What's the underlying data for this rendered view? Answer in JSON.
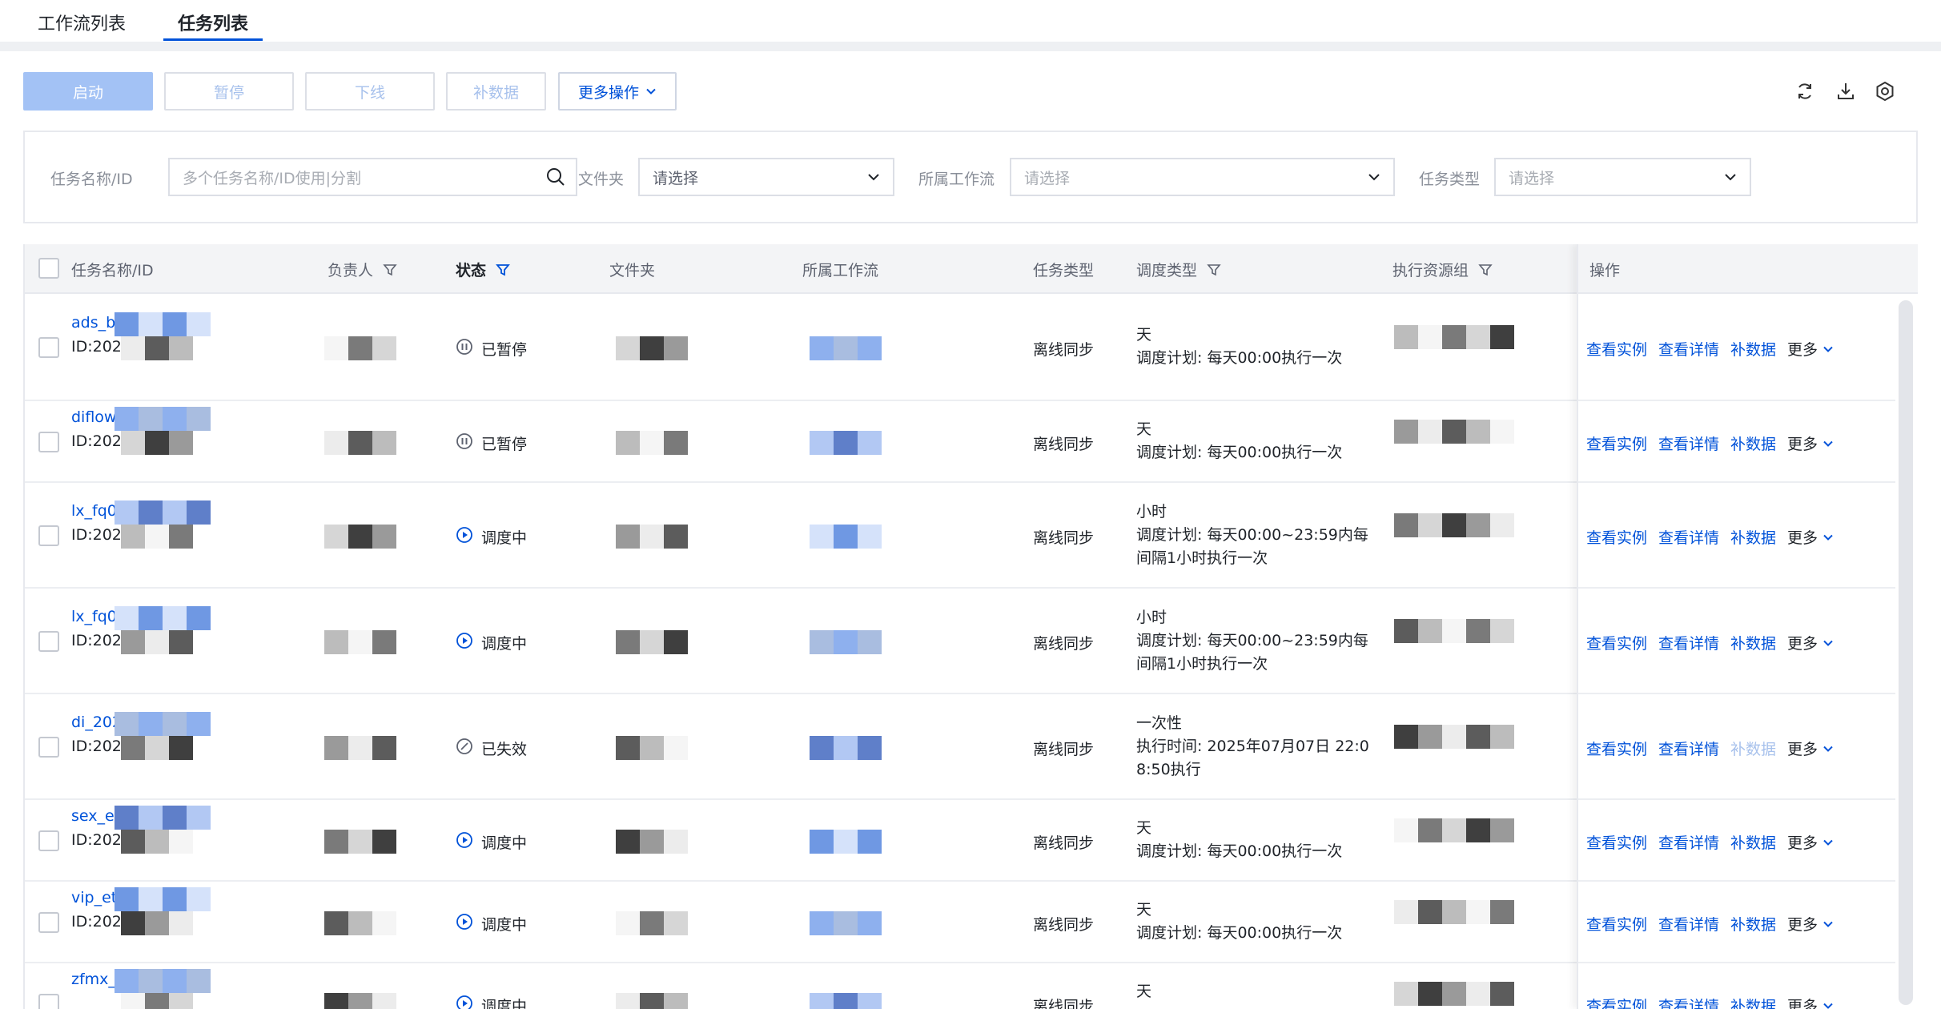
{
  "tabs": [
    {
      "label": "工作流列表",
      "active": false
    },
    {
      "label": "任务列表",
      "active": true
    }
  ],
  "toolbar": {
    "start": "启动",
    "pause": "暂停",
    "offline": "下线",
    "backfill": "补数据",
    "more_actions": "更多操作",
    "icons": [
      "refresh-icon",
      "download-icon",
      "settings-icon"
    ]
  },
  "filters": {
    "task_name_label": "任务名称/ID",
    "task_name_placeholder": "多个任务名称/ID使用|分割",
    "folder_label": "文件夹",
    "folder_placeholder": "请选择",
    "workflow_label": "所属工作流",
    "workflow_placeholder": "请选择",
    "task_type_label": "任务类型",
    "task_type_placeholder": "请选择"
  },
  "columns": {
    "name": "任务名称/ID",
    "owner": "负责人",
    "status": "状态",
    "folder": "文件夹",
    "workflow": "所属工作流",
    "task_type": "任务类型",
    "schedule_type": "调度类型",
    "resource_group": "执行资源组",
    "actions": "操作"
  },
  "row_actions": {
    "view_instances": "查看实例",
    "view_details": "查看详情",
    "backfill": "补数据",
    "more": "更多"
  },
  "rows": [
    {
      "name": "ads_bill",
      "id": "ID:2024",
      "status": "已暂停",
      "status_icon": "pause-icon",
      "task_type": "离线同步",
      "sched_line1": "天",
      "sched_line2": "调度计划: 每天00:00执行一次",
      "sched_line3": "",
      "backfill_enabled": true
    },
    {
      "name": "diflow1",
      "id": "ID:2025",
      "status": "已暂停",
      "status_icon": "pause-icon",
      "task_type": "离线同步",
      "sched_line1": "天",
      "sched_line2": "调度计划: 每天00:00执行一次",
      "sched_line3": "",
      "backfill_enabled": true
    },
    {
      "name": "lx_fq04",
      "id": "ID:202",
      "status": "调度中",
      "status_icon": "play-icon",
      "task_type": "离线同步",
      "sched_line1": "小时",
      "sched_line2": "调度计划: 每天00:00~23:59内每",
      "sched_line3": "间隔1小时执行一次",
      "backfill_enabled": true
    },
    {
      "name": "lx_fq0",
      "id": "ID:202",
      "status": "调度中",
      "status_icon": "play-icon",
      "task_type": "离线同步",
      "sched_line1": "小时",
      "sched_line2": "调度计划: 每天00:00~23:59内每",
      "sched_line3": "间隔1小时执行一次",
      "backfill_enabled": true
    },
    {
      "name": "di_202",
      "id": "ID:202",
      "status": "已失效",
      "status_icon": "invalid-icon",
      "task_type": "离线同步",
      "sched_line1": "一次性",
      "sched_line2": "执行时间: 2025年07月07日 22:0",
      "sched_line3": "8:50执行",
      "backfill_enabled": false
    },
    {
      "name": "sex_et",
      "id": "ID:202",
      "status": "调度中",
      "status_icon": "play-icon",
      "task_type": "离线同步",
      "sched_line1": "天",
      "sched_line2": "调度计划: 每天00:00执行一次",
      "sched_line3": "",
      "backfill_enabled": true
    },
    {
      "name": "vip_etl",
      "id": "ID:2025",
      "status": "调度中",
      "status_icon": "play-icon",
      "task_type": "离线同步",
      "sched_line1": "天",
      "sched_line2": "调度计划: 每天00:00执行一次",
      "sched_line3": "",
      "backfill_enabled": true
    },
    {
      "name": "zfmx_et",
      "id": "",
      "status": "调度中",
      "status_icon": "play-icon",
      "task_type": "离线同步",
      "sched_line1": "天",
      "sched_line2": "",
      "sched_line3": "",
      "backfill_enabled": true
    }
  ],
  "colors": {
    "primary": "#0052d9",
    "primary_disabled": "#a3c2f5",
    "border": "#dcdfe6"
  }
}
